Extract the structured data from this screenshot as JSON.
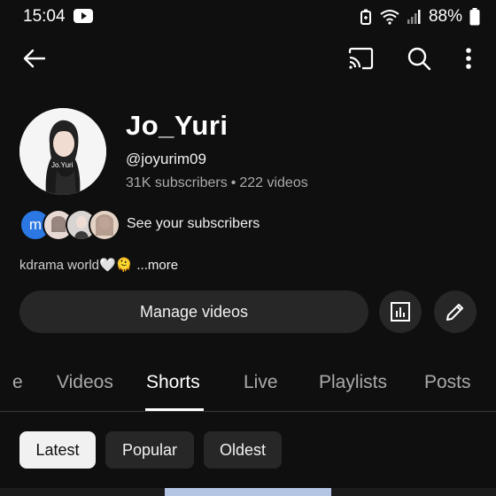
{
  "status_bar": {
    "time": "15:04",
    "battery": "88%"
  },
  "toolbar": {
    "back": "back-arrow",
    "cast": "cast-icon",
    "search": "search-icon",
    "more": "more-vert-icon"
  },
  "channel": {
    "name": "Jo_Yuri",
    "handle": "@joyurim09",
    "subscribers": "31K subscribers",
    "separator": "•",
    "videos": "222 videos",
    "see_subscribers": "See your subscribers",
    "subscriber_initial": "m",
    "avatar_caption": "Jo.Yuri",
    "description": "kdrama world🤍🫠",
    "more_label": "...more"
  },
  "actions": {
    "manage_videos": "Manage videos"
  },
  "tabs": [
    {
      "label": "e"
    },
    {
      "label": "Videos"
    },
    {
      "label": "Shorts"
    },
    {
      "label": "Live"
    },
    {
      "label": "Playlists"
    },
    {
      "label": "Posts"
    }
  ],
  "chips": [
    {
      "label": "Latest"
    },
    {
      "label": "Popular"
    },
    {
      "label": "Oldest"
    }
  ],
  "colors": {
    "background": "#0f0f0f",
    "button": "#272727",
    "accent_blue": "#2b78e4"
  }
}
